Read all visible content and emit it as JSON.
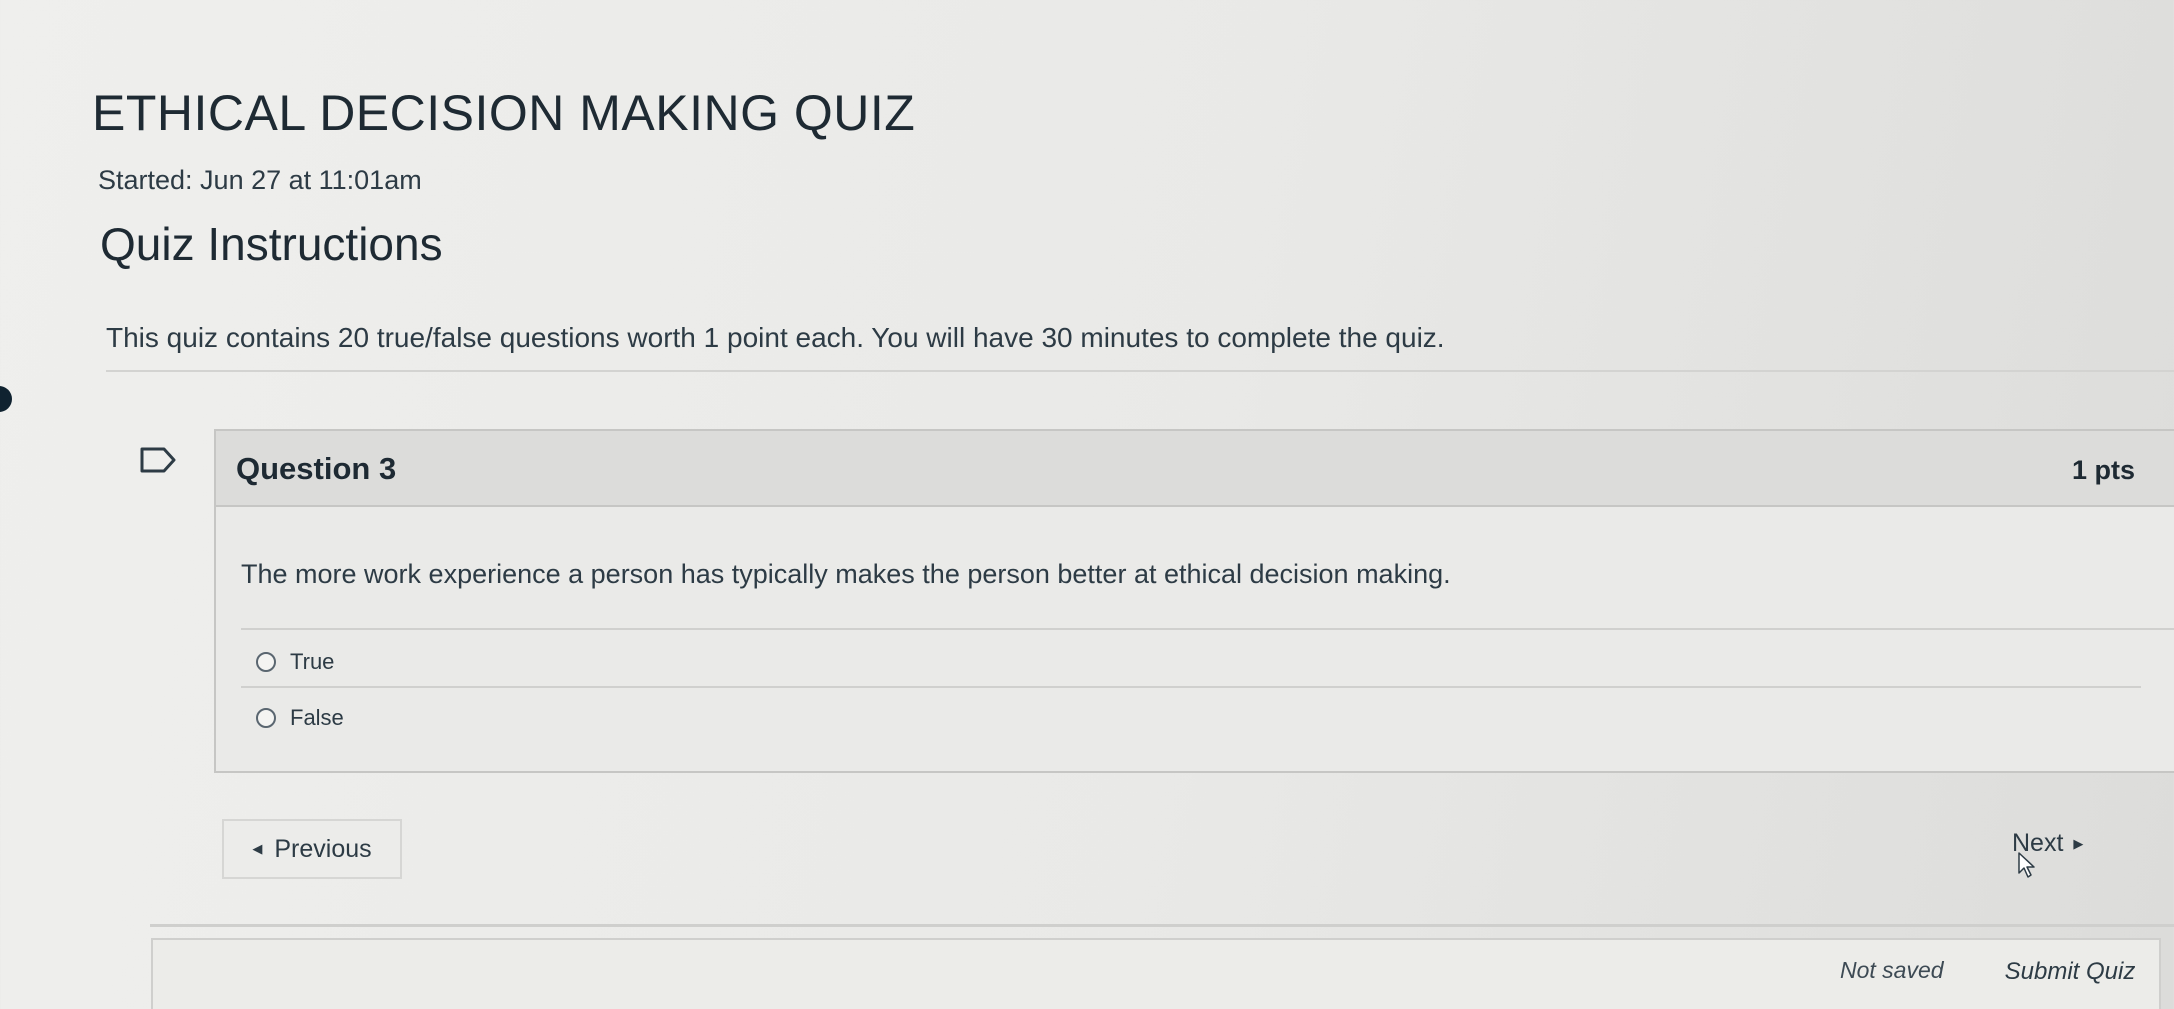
{
  "quiz": {
    "title": "ETHICAL DECISION MAKING QUIZ",
    "started": "Started: Jun 27 at 11:01am"
  },
  "instructions": {
    "heading": "Quiz Instructions",
    "text": "This quiz contains 20 true/false questions worth 1 point each. You will have 30 minutes to complete the quiz."
  },
  "question": {
    "name": "Question 3",
    "points": "1 pts",
    "text": "The more work experience a person has typically makes the person better at ethical decision making.",
    "answers": [
      {
        "label": "True"
      },
      {
        "label": "False"
      }
    ]
  },
  "navigation": {
    "previous_label": "Previous",
    "next_label": "Next"
  },
  "footer": {
    "status": "Not saved",
    "submit_label": "Submit Quiz"
  },
  "icons": {
    "flag": "flag-icon",
    "previous_arrow": "caret-left-icon",
    "next_arrow": "caret-right-icon",
    "cursor": "mouse-cursor-icon"
  },
  "colors": {
    "background": "#ececea",
    "text": "#2d3b45",
    "header_bg": "#dcdcda",
    "border": "#c6c6c4"
  }
}
